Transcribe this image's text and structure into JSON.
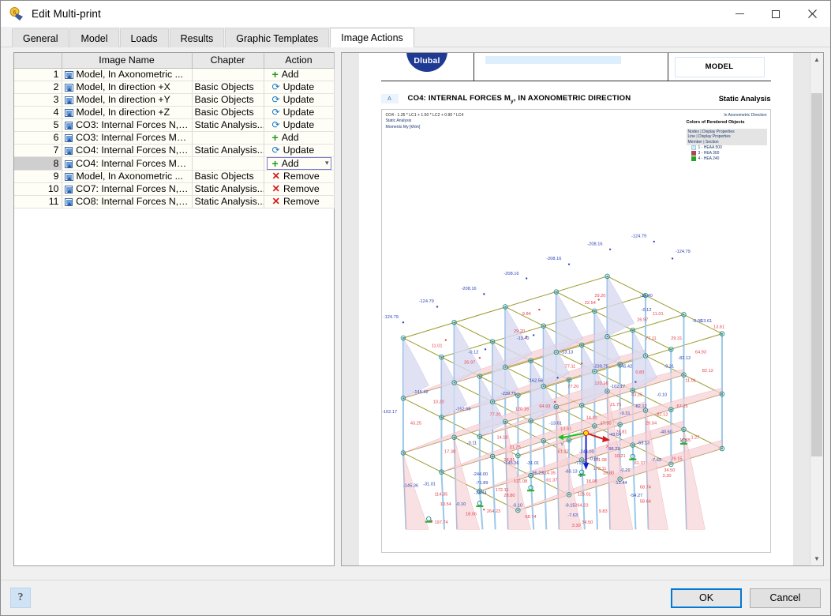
{
  "window": {
    "title": "Edit Multi-print",
    "icon": "print-settings-icon",
    "minimize": "–",
    "maximize": "□",
    "close": "✕"
  },
  "tabs": [
    {
      "label": "General",
      "active": false
    },
    {
      "label": "Model",
      "active": false
    },
    {
      "label": "Loads",
      "active": false
    },
    {
      "label": "Results",
      "active": false
    },
    {
      "label": "Graphic Templates",
      "active": false
    },
    {
      "label": "Image Actions",
      "active": true
    }
  ],
  "table": {
    "headers": [
      "",
      "Image Name",
      "Chapter",
      "Action"
    ],
    "rows": [
      {
        "num": "1",
        "name": "Model, In Axonometric ...",
        "chapter": "",
        "action": "Add",
        "action_type": "add",
        "selected": false
      },
      {
        "num": "2",
        "name": "Model, In direction +X",
        "chapter": "Basic Objects",
        "action": "Update",
        "action_type": "update",
        "selected": false
      },
      {
        "num": "3",
        "name": "Model, In direction +Y",
        "chapter": "Basic Objects",
        "action": "Update",
        "action_type": "update",
        "selected": false
      },
      {
        "num": "4",
        "name": "Model, In direction +Z",
        "chapter": "Basic Objects",
        "action": "Update",
        "action_type": "update",
        "selected": false
      },
      {
        "num": "5",
        "name": "CO3: Internal Forces N, I...",
        "chapter": "Static Analysis...",
        "action": "Update",
        "action_type": "update",
        "selected": false
      },
      {
        "num": "6",
        "name": "CO3: Internal Forces My, ...",
        "chapter": "",
        "action": "Add",
        "action_type": "add",
        "selected": false
      },
      {
        "num": "7",
        "name": "CO4: Internal Forces N, I...",
        "chapter": "Static Analysis...",
        "action": "Update",
        "action_type": "update",
        "selected": false
      },
      {
        "num": "8",
        "name": "CO4: Internal Forces My, ...",
        "chapter": "",
        "action": "Add",
        "action_type": "add",
        "selected": true
      },
      {
        "num": "9",
        "name": "Model, In Axonometric ...",
        "chapter": "Basic Objects",
        "action": "Remove",
        "action_type": "remove",
        "selected": false
      },
      {
        "num": "10",
        "name": "CO7: Internal Forces N, I...",
        "chapter": "Static Analysis...",
        "action": "Remove",
        "action_type": "remove",
        "selected": false
      },
      {
        "num": "11",
        "name": "CO8: Internal Forces N, I...",
        "chapter": "Static Analysis...",
        "action": "Remove",
        "action_type": "remove",
        "selected": false
      }
    ]
  },
  "preview": {
    "logo": "Dlubal",
    "model_box": "MODEL",
    "title_marker": "A",
    "title": "CO4: INTERNAL FORCES M",
    "title_sub": "y",
    "title_rest": ", IN AXONOMETRIC DIRECTION",
    "title_right": "Static Analysis",
    "caption_lines": [
      "CO4 - 1.35 * LC1 + 1.50 * LC2 + 0.90 * LC4",
      "Static Analysis",
      "Moments My [kNm]"
    ],
    "legend": {
      "direction": "In Axonometric Direction",
      "heading": "Colors of Rendered Objects",
      "property_lines": [
        "Nodes | Display Properties",
        "Line | Display Properties",
        "Member | Section"
      ],
      "items": [
        {
          "label": "1 - HEAA 500",
          "color": "#cdeef6"
        },
        {
          "label": "3 - HEA 300",
          "color": "#a84a54"
        },
        {
          "label": "4 - HEA 240",
          "color": "#23a423"
        }
      ]
    },
    "axis": {
      "x": "X",
      "y": "Y",
      "z": "Z"
    },
    "colors": {
      "positive_value": "#e8404a",
      "negative_value": "#2b44b8",
      "member": "#9a9a2e",
      "node": "#1f8a8a",
      "diagram_fill_pos": "#f7d4d8",
      "diagram_fill_neg": "#d5d8f2"
    }
  },
  "chart_data": {
    "type": "diagram",
    "title": "CO4: Internal Forces My, In Axonometric Direction",
    "unit": "kNm",
    "quantity": "Moments My",
    "negative_labels": [
      "-124.79",
      "-124.79",
      "-124.79",
      "-208.16",
      "-208.16",
      "-208.16",
      "-208.16",
      "-145.42",
      "-145.42",
      "-102.17",
      "-102.17",
      "-162.56",
      "-162.56",
      "-239.75",
      "-239.75",
      "-244.00",
      "-244.00",
      "-13.61",
      "-13.61",
      "-13.44",
      "-82.12",
      "-82.12",
      "-9.31",
      "-9.31",
      "-71.89",
      "-71.89",
      "-40.60",
      "-40.60",
      "-145.36",
      "-145.36",
      "-31.01",
      "-31.01",
      "-96.23",
      "-96.23",
      "-63.13",
      "-63.13",
      "-43.64",
      "-54.27",
      "-54.27",
      "-7.63",
      "-7.63",
      "-9.15",
      "-0.10",
      "-0.10",
      "-0.12",
      "-0.11",
      "-0.10",
      "-0.09",
      "-0.10",
      "-13.40",
      "-13.40",
      "-13.13",
      "-14.18",
      "-14.18",
      "-14.10",
      "-14.10",
      "-0.91",
      "-0.21"
    ],
    "positive_labels": [
      "11.01",
      "11.01",
      "11.01",
      "9.84",
      "22.54",
      "29.20",
      "29.20",
      "26.97",
      "26.97",
      "29.31",
      "64.93",
      "64.93",
      "77.11",
      "77.11",
      "77.20",
      "77.20",
      "120.16",
      "120.16",
      "10.20",
      "10.54",
      "17.30",
      "17.30",
      "28.81",
      "28.81",
      "28.80",
      "28.80",
      "13.61",
      "13.61",
      "21.75",
      "21.75",
      "61.27",
      "61.27",
      "61.37",
      "61.37",
      "43.25",
      "43.25",
      "82.12",
      "82.12",
      "121.08",
      "121.08",
      "114.35",
      "114.35",
      "172.11",
      "172.11",
      "67.25",
      "67.25",
      "68.74",
      "68.74",
      "18.06",
      "18.06",
      "1.27",
      "1.27",
      "10.21",
      "10.55",
      "10.55",
      "29.04",
      "29.15",
      "34.50",
      "34.50",
      "3.30",
      "3.30",
      "125.61",
      "125.61",
      "58.64",
      "58.64",
      "9.83",
      "197.74",
      "197.74",
      "264.23",
      "264.23",
      "226.31",
      "226.31",
      "179.73",
      "179.73",
      "9.83",
      "13.44"
    ],
    "support_reaction_labels": [
      "197.74",
      "264.23",
      "226.31",
      "226.31",
      "179.73",
      "179.73"
    ]
  },
  "footer": {
    "help": "?",
    "ok": "OK",
    "cancel": "Cancel"
  }
}
